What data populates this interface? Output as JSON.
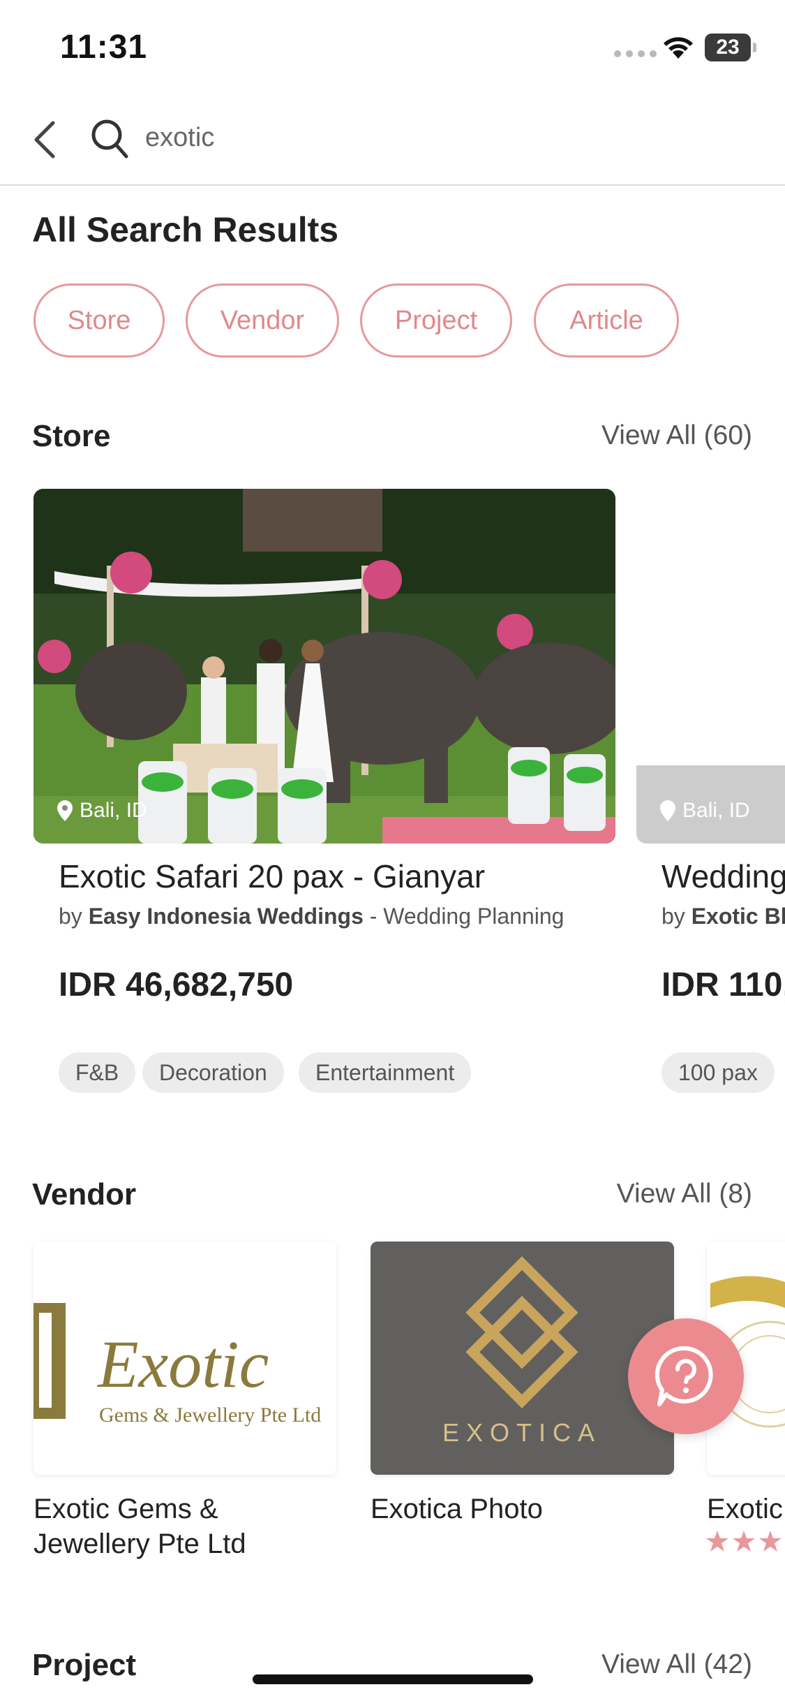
{
  "status": {
    "time": "11:31",
    "battery": "23"
  },
  "search": {
    "query": "exotic"
  },
  "results": {
    "title": "All Search Results",
    "filters": [
      "Store",
      "Vendor",
      "Project",
      "Article"
    ]
  },
  "store": {
    "title": "Store",
    "view_all": "View All (60)",
    "cards": [
      {
        "location": "Bali, ID",
        "title": "Exotic Safari 20 pax - Gianyar",
        "by_prefix": "by",
        "vendor": "Easy Indonesia Weddings",
        "category": "- Wedding Planning",
        "price": "IDR 46,682,750",
        "tags": [
          "F&B",
          "Decoration",
          "Entertainment"
        ]
      },
      {
        "location": "Bali, ID",
        "title": "Wedding",
        "by_prefix": "by",
        "vendor": "Exotic Bl",
        "category": "",
        "price": "IDR 110,",
        "tags": [
          "100 pax"
        ]
      }
    ]
  },
  "vendor": {
    "title": "Vendor",
    "view_all": "View All (8)",
    "items": [
      {
        "name_line1": "Exotic Gems &",
        "name_line2": "Jewellery Pte Ltd",
        "logo_word": "Exotic",
        "logo_sub": "Gems & Jewellery Pte Ltd"
      },
      {
        "name_line1": "Exotica Photo",
        "name_line2": "",
        "logo_word": "EXOTICA"
      },
      {
        "name_line1": "Exotic",
        "name_line2": ""
      }
    ]
  },
  "project": {
    "title": "Project",
    "view_all": "View All (42)"
  },
  "colors": {
    "accent": "#e8989a",
    "help_button": "#ec8b8f"
  }
}
